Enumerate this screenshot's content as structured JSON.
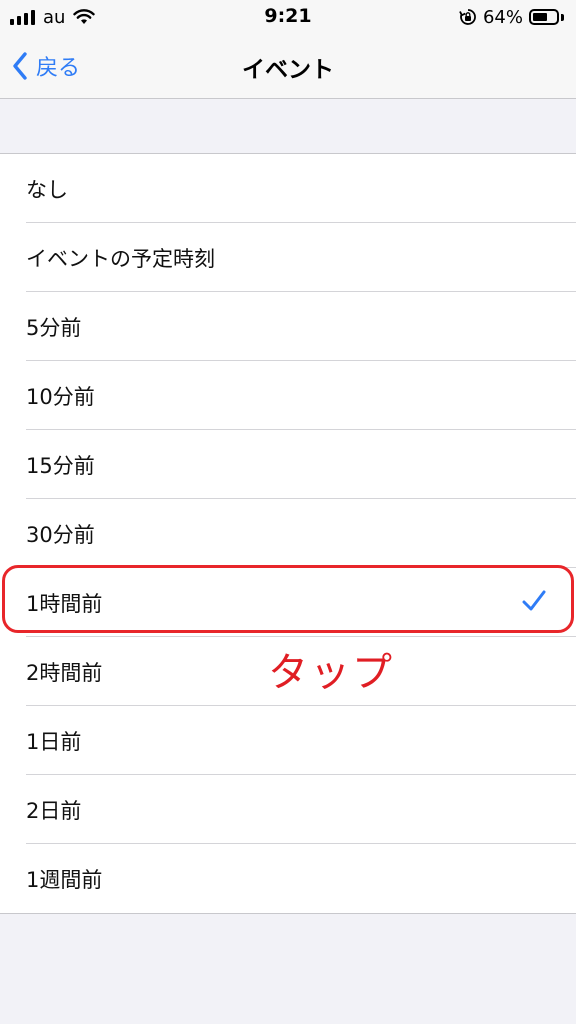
{
  "status_bar": {
    "carrier": "au",
    "time": "9:21",
    "battery_percent": "64%",
    "battery_level": 0.64
  },
  "nav": {
    "back_label": "戻る",
    "title": "イベント"
  },
  "options": [
    {
      "label": "なし",
      "selected": false
    },
    {
      "label": "イベントの予定時刻",
      "selected": false
    },
    {
      "label": "5分前",
      "selected": false
    },
    {
      "label": "10分前",
      "selected": false
    },
    {
      "label": "15分前",
      "selected": false
    },
    {
      "label": "30分前",
      "selected": false
    },
    {
      "label": "1時間前",
      "selected": true
    },
    {
      "label": "2時間前",
      "selected": false
    },
    {
      "label": "1日前",
      "selected": false
    },
    {
      "label": "2日前",
      "selected": false
    },
    {
      "label": "1週間前",
      "selected": false
    }
  ],
  "annotation": {
    "text": "タップ",
    "color": "#e01e24"
  },
  "colors": {
    "accent": "#2f7cf6",
    "highlight": "#e8262a"
  }
}
